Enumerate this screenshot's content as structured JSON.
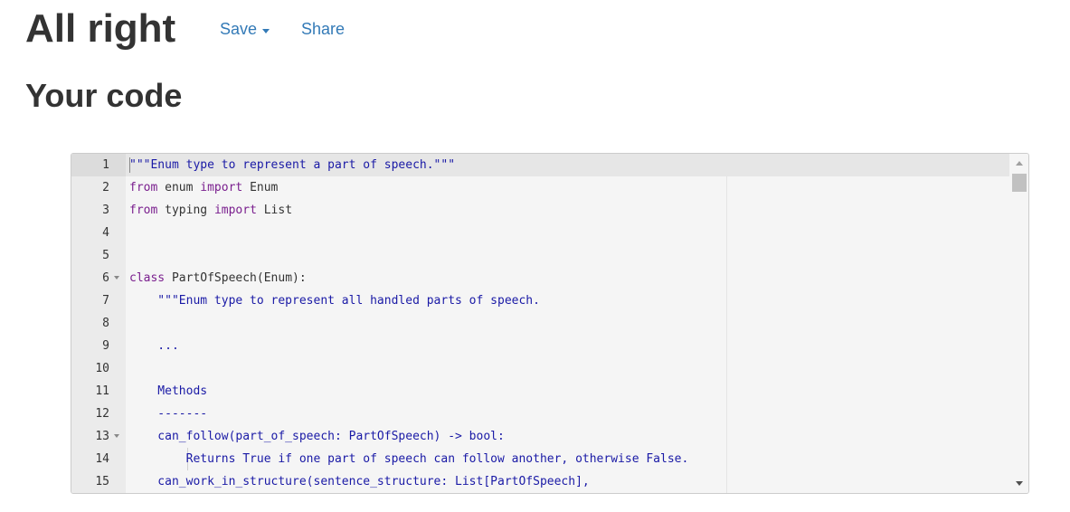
{
  "header": {
    "title": "All right",
    "save_label": "Save",
    "share_label": "Share"
  },
  "subtitle": "Your code",
  "editor": {
    "active_line": 1,
    "lines": [
      {
        "n": "1",
        "fold": false,
        "tokens": [
          [
            "str",
            "\"\"\"Enum type to represent a part of speech.\"\"\""
          ]
        ]
      },
      {
        "n": "2",
        "fold": false,
        "tokens": [
          [
            "kw",
            "from"
          ],
          [
            "plain",
            " enum "
          ],
          [
            "kw",
            "import"
          ],
          [
            "plain",
            " Enum"
          ]
        ]
      },
      {
        "n": "3",
        "fold": false,
        "tokens": [
          [
            "kw",
            "from"
          ],
          [
            "plain",
            " typing "
          ],
          [
            "kw",
            "import"
          ],
          [
            "plain",
            " List"
          ]
        ]
      },
      {
        "n": "4",
        "fold": false,
        "tokens": []
      },
      {
        "n": "5",
        "fold": false,
        "tokens": []
      },
      {
        "n": "6",
        "fold": true,
        "tokens": [
          [
            "kw",
            "class"
          ],
          [
            "plain",
            " PartOfSpeech(Enum):"
          ]
        ]
      },
      {
        "n": "7",
        "fold": false,
        "tokens": [
          [
            "str",
            "    \"\"\"Enum type to represent all handled parts of speech."
          ]
        ]
      },
      {
        "n": "8",
        "fold": false,
        "tokens": []
      },
      {
        "n": "9",
        "fold": false,
        "tokens": [
          [
            "str",
            "    ..."
          ]
        ]
      },
      {
        "n": "10",
        "fold": false,
        "tokens": []
      },
      {
        "n": "11",
        "fold": false,
        "tokens": [
          [
            "str",
            "    Methods"
          ]
        ]
      },
      {
        "n": "12",
        "fold": false,
        "tokens": [
          [
            "str",
            "    -------"
          ]
        ]
      },
      {
        "n": "13",
        "fold": true,
        "tokens": [
          [
            "str",
            "    can_follow(part_of_speech: PartOfSpeech) -> bool:"
          ]
        ]
      },
      {
        "n": "14",
        "fold": false,
        "guide": true,
        "tokens": [
          [
            "str",
            "        Returns True if one part of speech can follow another, otherwise False."
          ]
        ]
      },
      {
        "n": "15",
        "fold": false,
        "tokens": [
          [
            "str",
            "    can_work_in_structure(sentence_structure: List[PartOfSpeech],"
          ]
        ]
      }
    ]
  }
}
